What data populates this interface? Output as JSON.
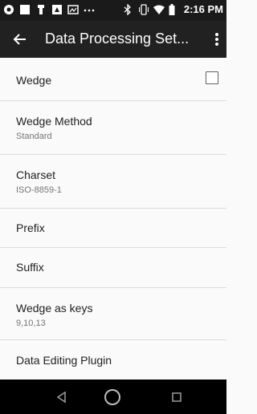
{
  "status": {
    "time": "2:16 PM"
  },
  "appbar": {
    "title": "Data Processing Set..."
  },
  "settings": [
    {
      "label": "Wedge",
      "checkbox": true
    },
    {
      "label": "Wedge Method",
      "value": "Standard"
    },
    {
      "label": "Charset",
      "value": "ISO-8859-1"
    },
    {
      "label": "Prefix"
    },
    {
      "label": "Suffix"
    },
    {
      "label": "Wedge as keys",
      "value": "9,10,13"
    },
    {
      "label": "Data Editing Plugin"
    }
  ],
  "colors": {
    "statusbar": "#1a1a1a",
    "appbar": "#212121",
    "navbar": "#000000",
    "background": "#fafafa"
  }
}
